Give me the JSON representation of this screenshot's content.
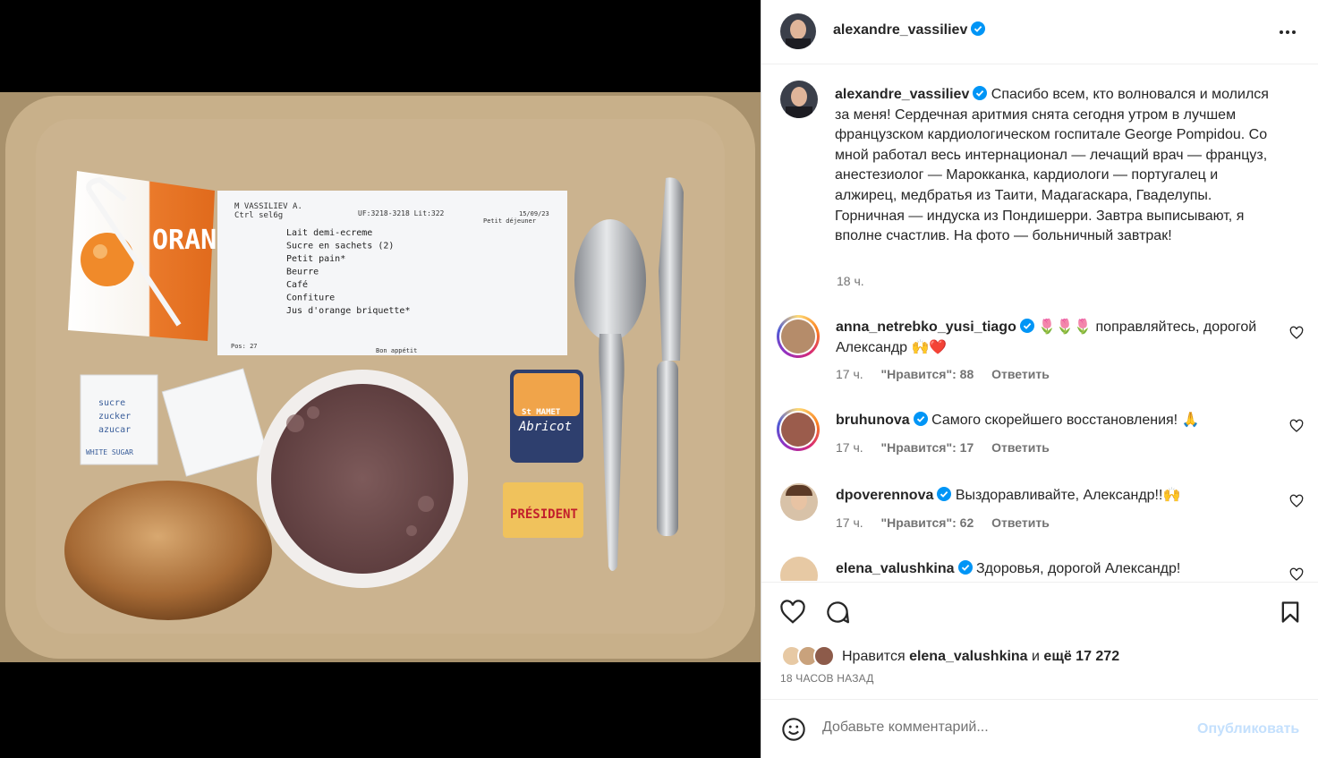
{
  "post": {
    "author": "alexandre_vassiliev",
    "caption": "Спасибо всем, кто волновался и молился за меня! Сердечная аритмия снята сегодня утром в лучшем французском кардиологическом госпитале George Pompidou. Со мной работал весь интернационал — лечащий врач — француз, анестезиолог — Марокканка, кардиологи — португалец и алжирец, медбратья из Таити, Мадагаскара, Гваделупы. Горничная — индуска из Пондишерри. Завтра выписывают, я вполне счастлив. На фото — больничный завтрак!",
    "caption_time": "18 ч.",
    "likes_prefix": "Нравится",
    "likes_user": "elena_valushkina",
    "likes_and": "и",
    "likes_rest": "ещё 17 272",
    "date": "18 ЧАСОВ НАЗАД"
  },
  "photo": {
    "note": {
      "name": "M VASSILIEV A.",
      "sub": "Ctrl sel6g",
      "code": "UF:3218-3218 Lit:322",
      "date": "15/09/23",
      "meal": "Petit déjeuner",
      "items": [
        "Lait demi-ecreme",
        "Sucre en sachets (2)",
        "Petit pain*",
        "Beurre",
        "Café",
        "Confiture",
        "Jus d'orange briquette*"
      ],
      "pos": "Pos: 27",
      "footer": "Bon appétit"
    },
    "juice_text": "ORANGE",
    "jam_brand": "St MAMET",
    "jam_flavor": "Abricot",
    "butter_brand": "PRÉSIDENT",
    "sugar_words": [
      "sucre",
      "zucker",
      "azucar",
      "WHITE SUGAR"
    ]
  },
  "comments": [
    {
      "user": "anna_netrebko_yusi_tiago",
      "text": "🌷🌷🌷 поправляйтесь, дорогой Александр 🙌❤️",
      "time": "17 ч.",
      "likes": "\"Нравится\": 88",
      "reply": "Ответить"
    },
    {
      "user": "bruhunova",
      "text": "Самого скорейшего восстановления! 🙏",
      "time": "17 ч.",
      "likes": "\"Нравится\": 17",
      "reply": "Ответить"
    },
    {
      "user": "dpoverennova",
      "text": "Выздоравливайте, Александр!!🙌",
      "time": "17 ч.",
      "likes": "\"Нравится\": 62",
      "reply": "Ответить"
    },
    {
      "user": "elena_valushkina",
      "text": "Здоровья, дорогой Александр!",
      "time": "",
      "likes": "",
      "reply": ""
    }
  ],
  "comment_input": {
    "placeholder": "Добавьте комментарий...",
    "publish": "Опубликовать"
  },
  "colors": {
    "verified": "#0095f6",
    "heart_red": "#ed4956",
    "publish_disabled": "#c4e0fd",
    "tray": "#c8b08a"
  },
  "icons": [
    "verified-icon",
    "more-icon",
    "like-icon",
    "comment-icon",
    "bookmark-icon",
    "emoji-icon"
  ]
}
